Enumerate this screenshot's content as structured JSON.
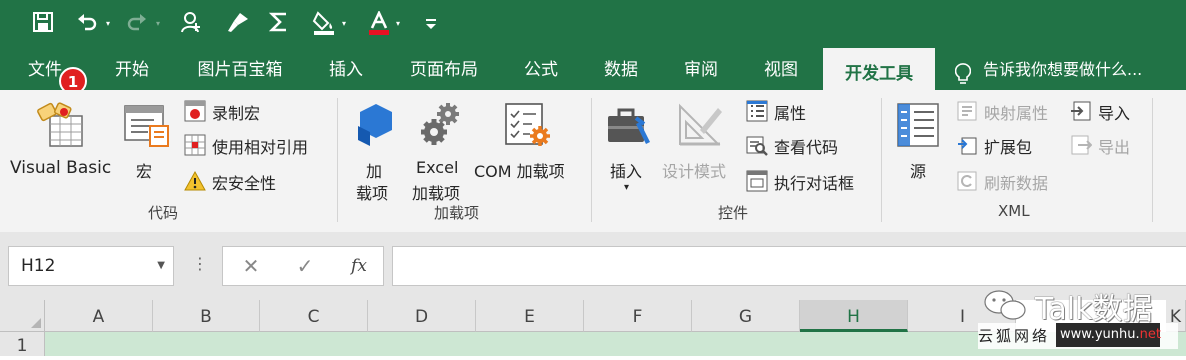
{
  "colors": {
    "excel_green": "#217346",
    "ribbon_bg": "#f3f3f3",
    "badge_red": "#e02020",
    "row_select": "#cde7d3"
  },
  "qat": {
    "icons": [
      "save-icon",
      "undo-icon",
      "redo-icon",
      "person-add-icon",
      "format-painter-icon",
      "sum-icon",
      "fill-color-icon",
      "font-color-icon",
      "customize-icon"
    ]
  },
  "tabs": [
    "文件",
    "开始",
    "图片百宝箱",
    "插入",
    "页面布局",
    "公式",
    "数据",
    "审阅",
    "视图",
    "开发工具"
  ],
  "active_tab": "开发工具",
  "tell_me": "告诉我你想要做什么...",
  "badge": "1",
  "ribbon": {
    "code": {
      "visual_basic": "Visual Basic",
      "macros": "宏",
      "record_macro": "录制宏",
      "relative_ref": "使用相对引用",
      "macro_security": "宏安全性",
      "group_label": "代码"
    },
    "addins": {
      "addins_line1": "加",
      "addins_line2": "载项",
      "excel_line1": "Excel",
      "excel_line2": "加载项",
      "com": "COM 加载项",
      "group_label": "加载项"
    },
    "controls": {
      "insert": "插入",
      "design_mode": "设计模式",
      "properties": "属性",
      "view_code": "查看代码",
      "run_dialog": "执行对话框",
      "group_label": "控件"
    },
    "xml": {
      "source": "源",
      "map_properties": "映射属性",
      "expansion_packs": "扩展包",
      "refresh_data": "刷新数据",
      "import": "导入",
      "export": "导出",
      "group_label": "XML"
    }
  },
  "formula_bar": {
    "name_box": "H12",
    "cancel": "✕",
    "enter": "✓",
    "fx": "fx",
    "formula": ""
  },
  "grid": {
    "columns": [
      "A",
      "B",
      "C",
      "D",
      "E",
      "F",
      "G",
      "H",
      "I",
      "K"
    ],
    "selected_column": "H",
    "row": "1"
  },
  "watermark": {
    "wechat": "Talk数据",
    "site_cn": "云狐网络",
    "site_url_a": "www.yunhu.",
    "site_url_b": "net"
  }
}
